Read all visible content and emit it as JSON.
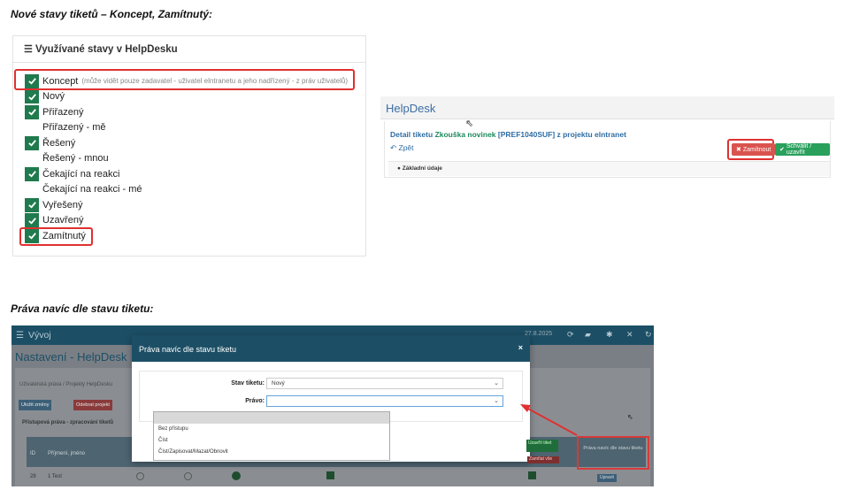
{
  "headings": {
    "first": "Nové stavy tiketů – Koncept, Zamítnutý:",
    "second": "Práva navíc dle stavu tiketu:"
  },
  "status_panel": {
    "title": "Využívané stavy v HelpDesku",
    "items": [
      {
        "label": "Koncept",
        "checked": true,
        "hint": "(může vidět pouze zadavatel - uživatel elntranetu a jeho nadřízený - z práv uživatelů)"
      },
      {
        "label": "Nový",
        "checked": true
      },
      {
        "label": "Přiřazený",
        "checked": true
      },
      {
        "label": "Přiřazený - mě",
        "checked": false
      },
      {
        "label": "Řešený",
        "checked": true
      },
      {
        "label": "Řešený - mnou",
        "checked": false
      },
      {
        "label": "Čekající na reakci",
        "checked": true
      },
      {
        "label": "Čekající na reakci - mé",
        "checked": false
      },
      {
        "label": "Vyřešený",
        "checked": true
      },
      {
        "label": "Uzavřený",
        "checked": true
      },
      {
        "label": "Zamítnutý",
        "checked": true
      }
    ]
  },
  "ticket_panel": {
    "app_title": "HelpDesk",
    "detail_prefix": "Detail tiketu",
    "ticket_name": "Zkouška novinek",
    "detail_suffix": "[PREF1040SUF] z projektu elntranet",
    "back_label": "Zpět",
    "reject_label": "Zamítnout",
    "approve_label": "Schválit / uzavřít",
    "section_label": "Základní údaje"
  },
  "app_panel": {
    "app_name": "Vývoj",
    "date": "27.8.2025",
    "page_title": "Nastavení - HelpDesk",
    "breadcrumb": "Uživatelská práva / Projekty HelpDesku",
    "save_button": "Uložit změny",
    "delete_button": "Odebrat projekt",
    "subtitle": "Přístupová práva - zpracování tiketů",
    "table_headers": {
      "id": "ID",
      "name": "Příjmení, jméno"
    },
    "row": {
      "id": "28",
      "name": "1 Test"
    },
    "col_label_green": "Uzavřít tiket",
    "col_label_red": "Zamítat vše",
    "highlight_header": "Práva navíc dle stavu tiketu",
    "edit_label": "Upravit"
  },
  "modal": {
    "title": "Práva navíc dle stavu tiketu",
    "status_label": "Stav tiketu:",
    "status_value": "Nový",
    "right_label": "Právo:",
    "right_value": "",
    "options": [
      "",
      "Bez přístupu",
      "Číst",
      "Číst/Zapisovat/Mazat/Obnovit"
    ]
  },
  "colors": {
    "check_green": "#1f7a4d",
    "highlight_red": "#e03030",
    "app_dark": "#1c4f66",
    "reject": "#d9534f",
    "approve": "#29a05c"
  }
}
